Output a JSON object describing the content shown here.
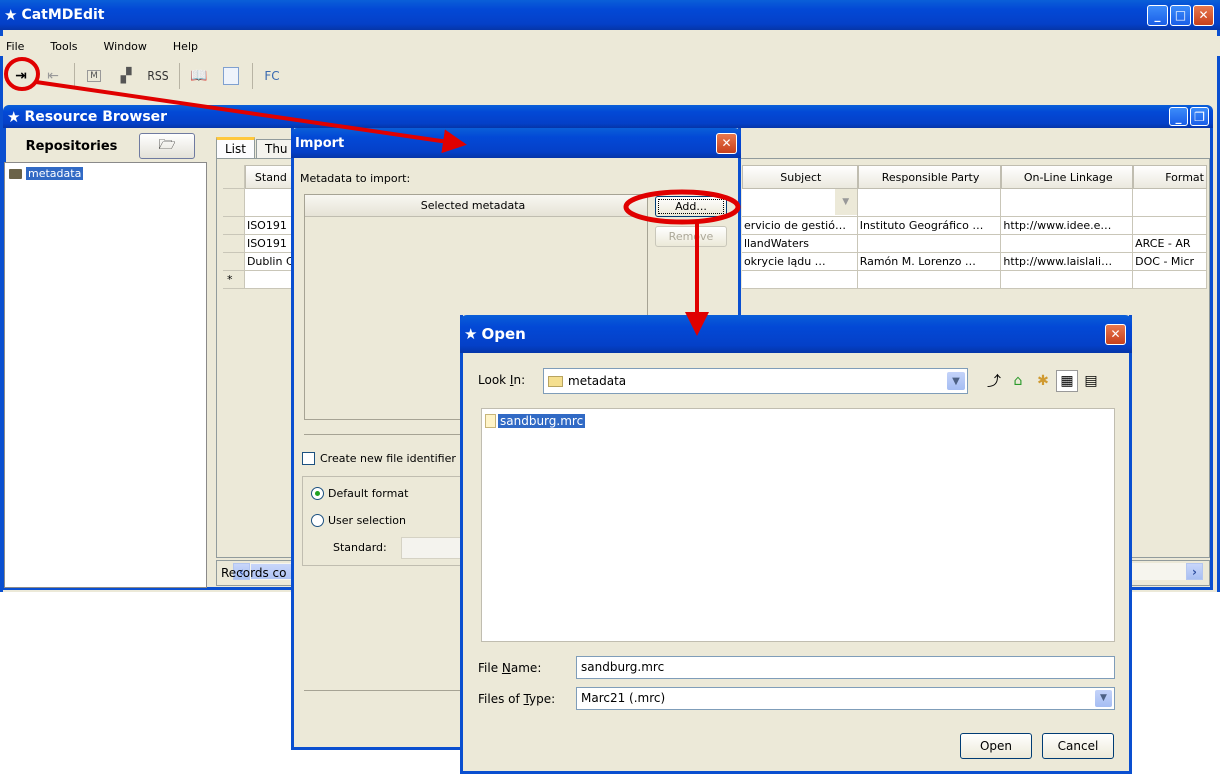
{
  "app": {
    "title": "CatMDEdit"
  },
  "menu": [
    "File",
    "Tools",
    "Window",
    "Help"
  ],
  "toolbar": {
    "rss_label": "RSS",
    "fc_label": "FC"
  },
  "resource_browser": {
    "title": "Resource Browser",
    "repositories_label": "Repositories",
    "tree": [
      {
        "label": "metadata",
        "selected": true
      }
    ],
    "tabs": [
      {
        "label": "List",
        "active": true
      },
      {
        "label": "Thu",
        "active": false
      }
    ],
    "columns": [
      "Stand",
      "Subject",
      "Responsible Party",
      "On-Line Linkage",
      "Format"
    ],
    "rows": [
      {
        "std": "ISO191",
        "subject": "ervicio de gestió…",
        "party": "Instituto Geográfico …",
        "link": "http://www.idee.e…",
        "format": ""
      },
      {
        "std": "ISO191",
        "subject": "llandWaters",
        "party": "",
        "link": "",
        "format": "ARCE - AR"
      },
      {
        "std": "Dublin C",
        "subject": "okrycie lądu      …",
        "party": "Ramón M. Lorenzo …",
        "link": "http://www.laislali…",
        "format": "DOC - Micr"
      }
    ],
    "new_row_marker": "*",
    "status": "Records co"
  },
  "import_dialog": {
    "title": "Import",
    "metadata_label": "Metadata to import:",
    "list_header": "Selected metadata",
    "add_label": "Add...",
    "remove_label": "Remove",
    "create_identifier_label": "Create new file identifier",
    "create_identifier_checked": false,
    "format_options": [
      {
        "label": "Default format",
        "selected": true
      },
      {
        "label": "User selection",
        "selected": false
      }
    ],
    "standard_label": "Standard:",
    "standard_value": ""
  },
  "open_dialog": {
    "title": "Open",
    "look_in_label": "Look In:",
    "look_in_value": "metadata",
    "files": [
      {
        "name": "sandburg.mrc",
        "selected": true
      }
    ],
    "file_name_label": "File Name:",
    "file_name_value": "sandburg.mrc",
    "files_of_type_label": "Files of Type:",
    "files_of_type_value": "Marc21 (.mrc)",
    "open_label": "Open",
    "cancel_label": "Cancel"
  },
  "annotation_color": "#e00000"
}
